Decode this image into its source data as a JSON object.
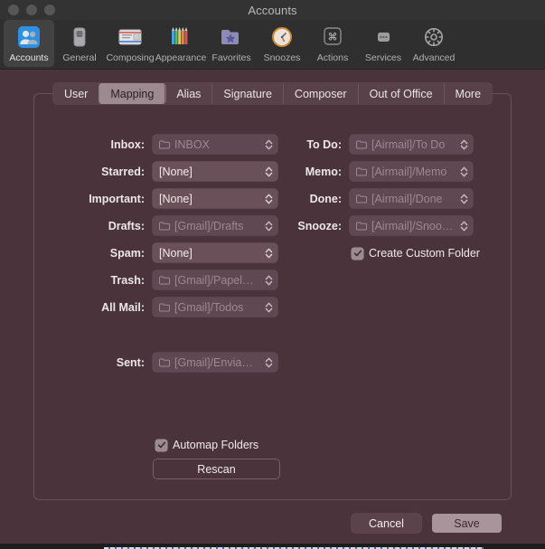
{
  "window": {
    "title": "Accounts",
    "traffic_lights": [
      "close-button",
      "minimize-button",
      "zoom-button"
    ]
  },
  "toolbar": {
    "items": [
      {
        "label": "Accounts",
        "icon": "accounts-people-icon",
        "selected": true
      },
      {
        "label": "General",
        "icon": "toggle-switch-icon",
        "selected": false
      },
      {
        "label": "Composing",
        "icon": "airmail-envelope-icon",
        "selected": false
      },
      {
        "label": "Appearance",
        "icon": "colored-pencils-icon",
        "selected": false
      },
      {
        "label": "Favorites",
        "icon": "star-folder-icon",
        "selected": false
      },
      {
        "label": "Snoozes",
        "icon": "clock-icon",
        "selected": false
      },
      {
        "label": "Actions",
        "icon": "command-key-icon",
        "selected": false
      },
      {
        "label": "Services",
        "icon": "ellipsis-box-icon",
        "selected": false
      },
      {
        "label": "Advanced",
        "icon": "gear-icon",
        "selected": false
      }
    ]
  },
  "tabs": [
    {
      "label": "User",
      "active": false
    },
    {
      "label": "Mapping",
      "active": true
    },
    {
      "label": "Alias",
      "active": false
    },
    {
      "label": "Signature",
      "active": false
    },
    {
      "label": "Composer",
      "active": false
    },
    {
      "label": "Out of Office",
      "active": false
    },
    {
      "label": "More",
      "active": false
    }
  ],
  "mapping": {
    "left_fields": [
      {
        "label": "Inbox:",
        "value": "INBOX",
        "disabled": true,
        "folder_icon": true
      },
      {
        "label": "Starred:",
        "value": "[None]",
        "disabled": false,
        "folder_icon": false
      },
      {
        "label": "Important:",
        "value": "[None]",
        "disabled": false,
        "folder_icon": false
      },
      {
        "label": "Drafts:",
        "value": "[Gmail]/Drafts",
        "disabled": true,
        "folder_icon": true
      },
      {
        "label": "Spam:",
        "value": "[None]",
        "disabled": false,
        "folder_icon": false
      },
      {
        "label": "Trash:",
        "value": "[Gmail]/Papel…",
        "disabled": true,
        "folder_icon": true
      },
      {
        "label": "All Mail:",
        "value": "[Gmail]/Todos",
        "disabled": true,
        "folder_icon": true
      },
      {
        "label": "Sent:",
        "value": "[Gmail]/Envia…",
        "disabled": true,
        "folder_icon": true
      }
    ],
    "right_fields": [
      {
        "label": "To Do:",
        "value": "[Airmail]/To Do",
        "disabled": true,
        "folder_icon": true
      },
      {
        "label": "Memo:",
        "value": "[Airmail]/Memo",
        "disabled": true,
        "folder_icon": true
      },
      {
        "label": "Done:",
        "value": "[Airmail]/Done",
        "disabled": true,
        "folder_icon": true
      },
      {
        "label": "Snooze:",
        "value": "[Airmail]/Snoo…",
        "disabled": true,
        "folder_icon": true
      }
    ],
    "create_custom_folder": {
      "label": "Create Custom Folder",
      "checked": true
    },
    "automap_folders": {
      "label": "Automap Folders",
      "checked": true
    },
    "rescan_button": "Rescan"
  },
  "footer": {
    "cancel_label": "Cancel",
    "save_label": "Save"
  },
  "colors": {
    "window_bg": "#4a333a",
    "titlebar_bg": "#333334",
    "toolbar_bg": "#2f2f30",
    "accent_blue": "#3b8de0",
    "tab_active_bg": "#9c8a90",
    "save_button_bg": "#a8959b"
  }
}
